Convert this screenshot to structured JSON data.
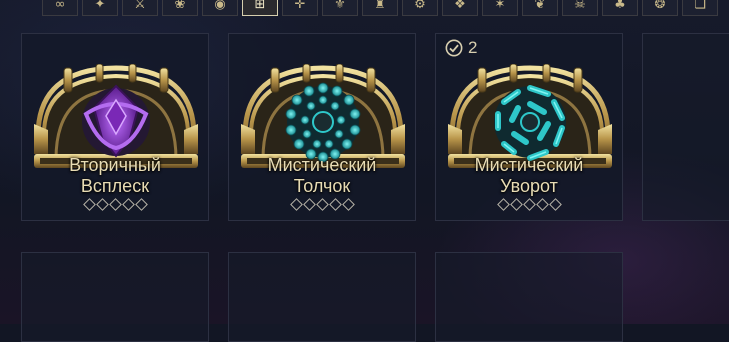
{
  "filters": {
    "icons": [
      "infinity-icon",
      "wing-icon",
      "runner-icon",
      "flower-icon",
      "mask-icon",
      "frame-icon",
      "target-icon",
      "shield-icon",
      "tower-icon",
      "nodes-icon",
      "beast-icon",
      "mark-icon",
      "leaf-icon",
      "skull-icon",
      "tree-icon",
      "crest-icon",
      "layers-icon"
    ],
    "glyphs": [
      "∞",
      "✦",
      "⚔",
      "❀",
      "◉",
      "⊞",
      "✛",
      "⚜",
      "♜",
      "⚙",
      "❖",
      "✶",
      "❦",
      "☠",
      "♣",
      "❂",
      "❏"
    ],
    "active_index": 5
  },
  "mods": [
    {
      "line1": "Вторичный",
      "line2": "Всплеск",
      "color": "#8a36c9",
      "ranks": 5
    },
    {
      "line1": "Мистический",
      "line2": "Толчок",
      "color": "#2ec7c9",
      "ranks": 5
    },
    {
      "line1": "Мистический",
      "line2": "Уворот",
      "color": "#2ec7c9",
      "ranks": 5
    }
  ],
  "owned_count": "2",
  "colors": {
    "gold": "#c9b98a",
    "text": "#e8dcb4",
    "purple": "#8a36c9",
    "cyan": "#2ec7c9"
  }
}
